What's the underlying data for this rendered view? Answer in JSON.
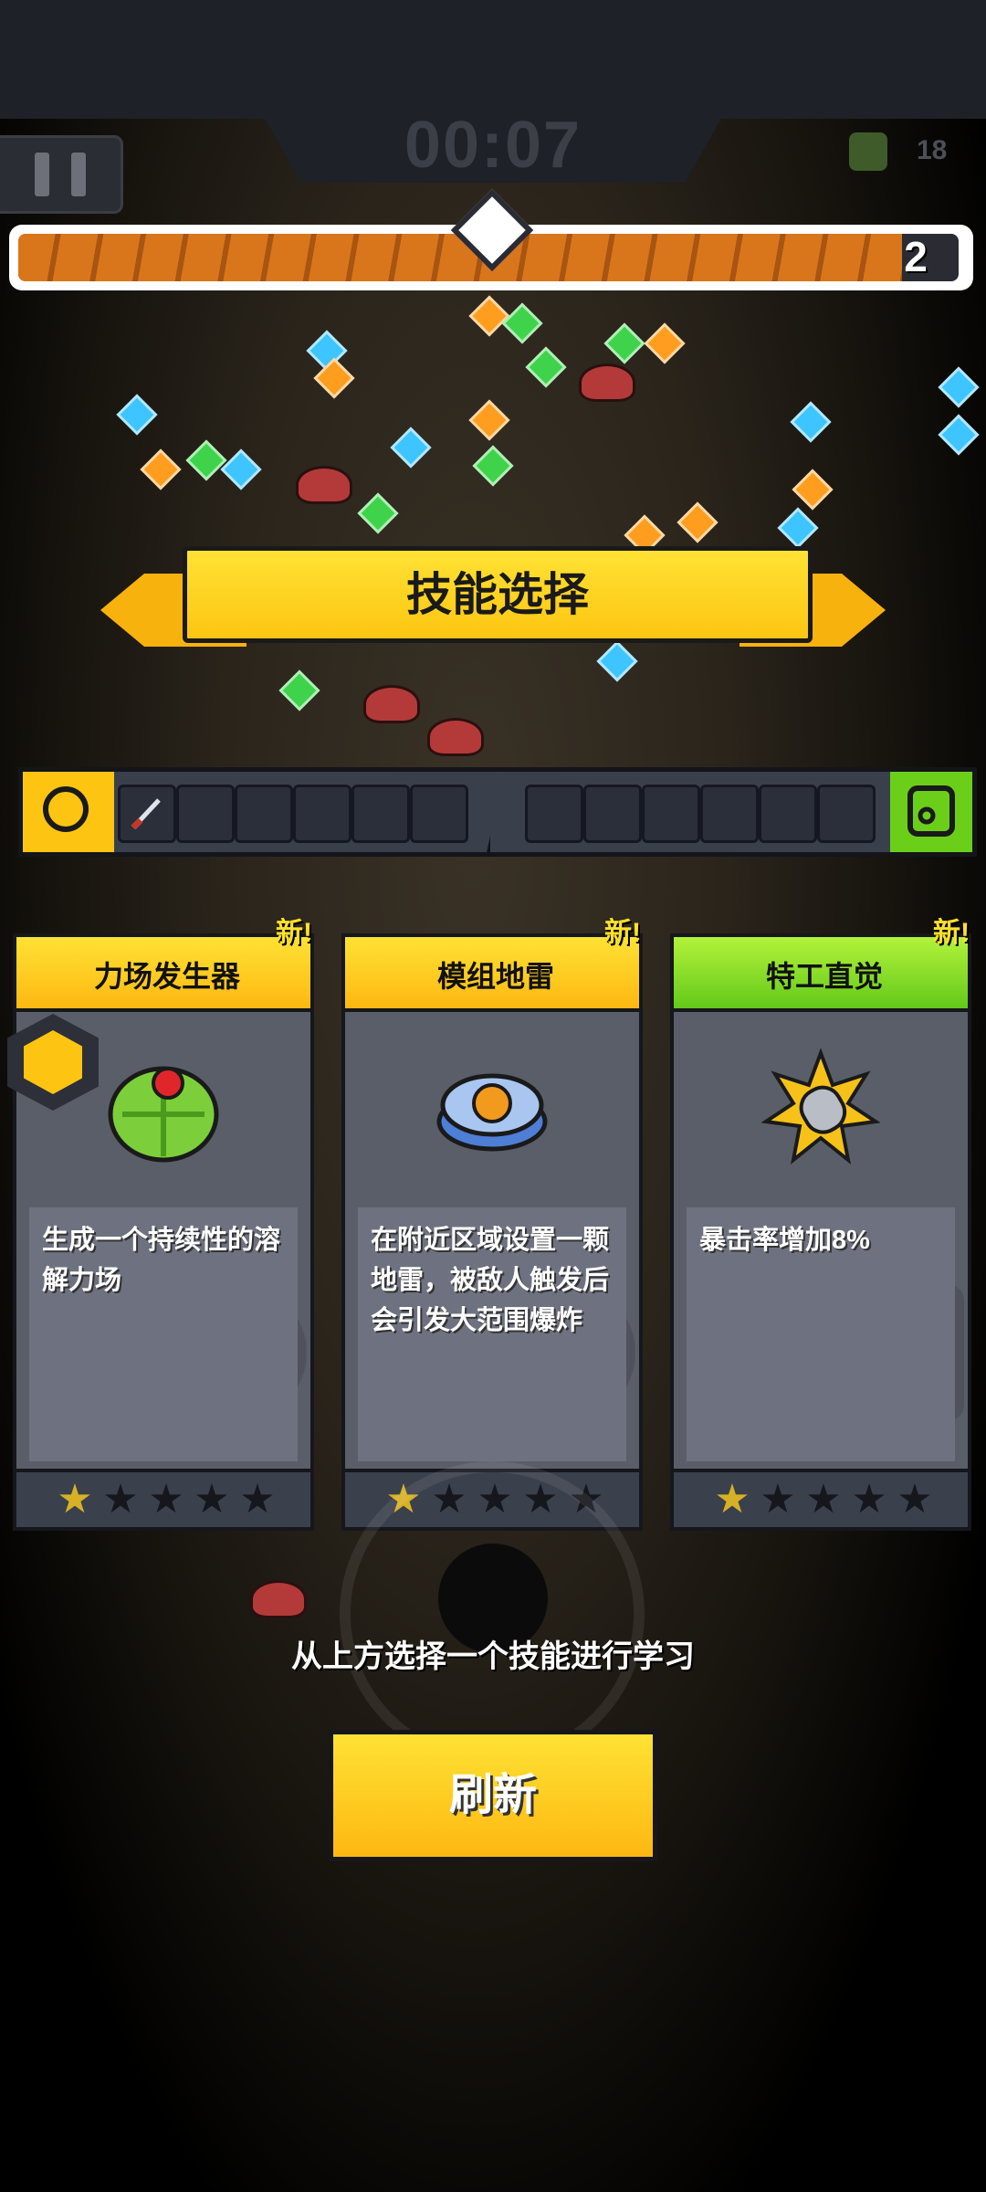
{
  "hud": {
    "timer": "00:07",
    "kill_count": "18",
    "level": "2",
    "xp_progress": 0.94
  },
  "title": "技能选择",
  "cards": [
    {
      "name": "力场发生器",
      "new_label": "新!",
      "description": "生成一个持续性的溶解力场",
      "stars_filled": 1,
      "stars_total": 5,
      "header_color": "#fdc512"
    },
    {
      "name": "模组地雷",
      "new_label": "新!",
      "description": "在附近区域设置一颗地雷，被敌人触发后会引发大范围爆炸",
      "stars_filled": 1,
      "stars_total": 5,
      "header_color": "#fdc512"
    },
    {
      "name": "特工直觉",
      "new_label": "新!",
      "description": "暴击率增加8%",
      "stars_filled": 1,
      "stars_total": 5,
      "header_color": "#7bd11c"
    }
  ],
  "hint": "从上方选择一个技能进行学习",
  "refresh_label": "刷新",
  "icons": {
    "pause": "pause-icon",
    "kills": "robot-kill-icon",
    "weapon_slots": "crosshair-icon",
    "passive_slots": "chip-icon",
    "equipped_weapon": "knife-icon"
  }
}
